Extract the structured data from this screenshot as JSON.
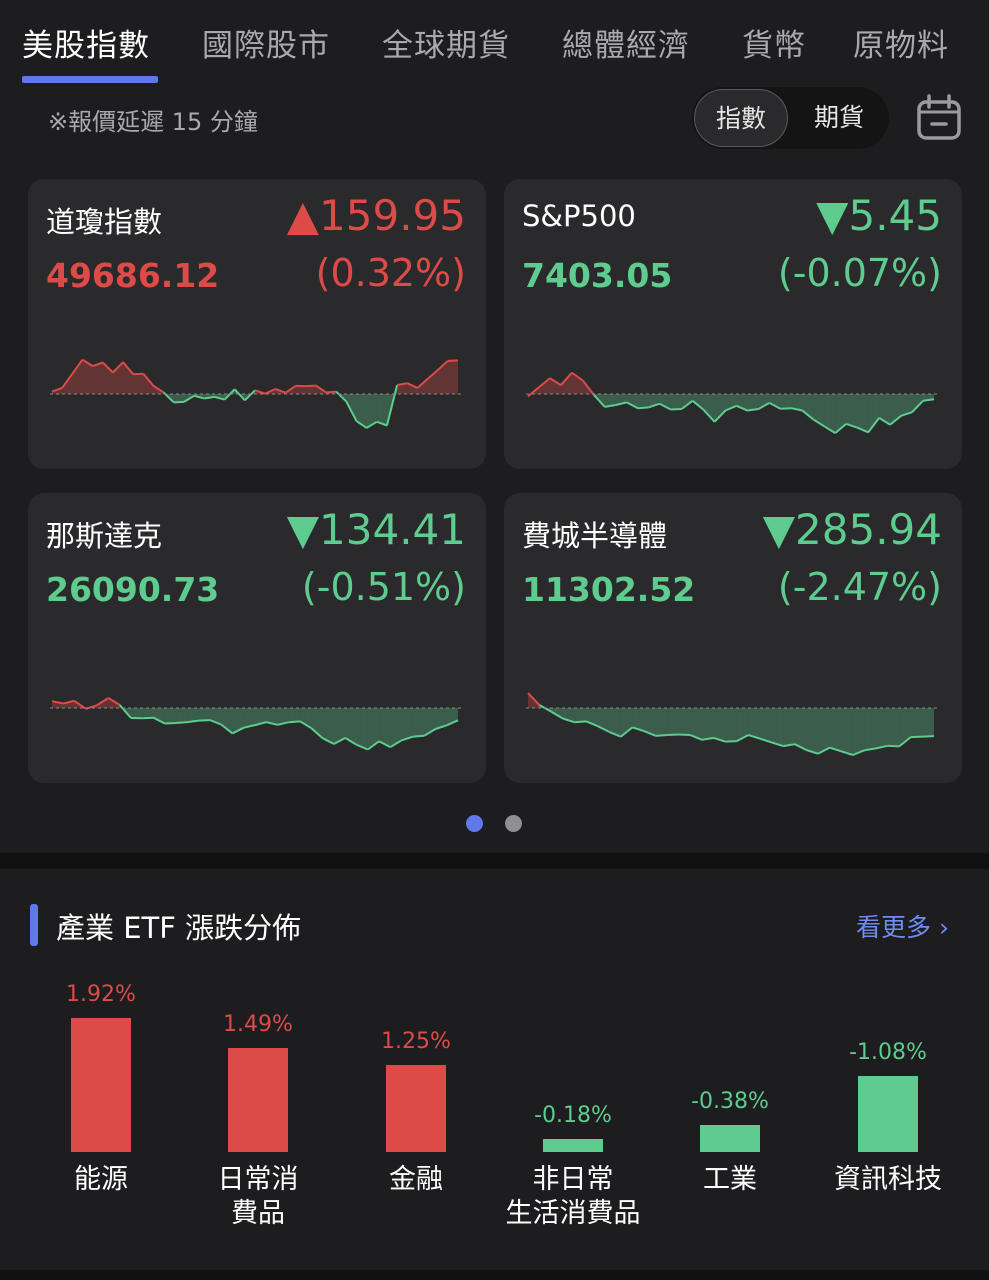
{
  "tabs": [
    "美股指數",
    "國際股市",
    "全球期貨",
    "總體經濟",
    "貨幣",
    "原物料"
  ],
  "delay_note": "※報價延遲 15 分鐘",
  "segment": {
    "active": "指數",
    "inactive": "期貨"
  },
  "cards": [
    {
      "name": "道瓊指數",
      "change": "▲159.95",
      "price": "49686.12",
      "pct": "(0.32%)",
      "direction": "up"
    },
    {
      "name": "S&P500",
      "change": "▼5.45",
      "price": "7403.05",
      "pct": "(-0.07%)",
      "direction": "down"
    },
    {
      "name": "那斯達克",
      "change": "▼134.41",
      "price": "26090.73",
      "pct": "(-0.51%)",
      "direction": "down"
    },
    {
      "name": "費城半導體",
      "change": "▼285.94",
      "price": "11302.52",
      "pct": "(-2.47%)",
      "direction": "down"
    }
  ],
  "etf_section": {
    "title": "產業 ETF 漲跌分佈",
    "see_more": "看更多 ›",
    "items": [
      {
        "label_line1": "能源",
        "label_line2": "",
        "value": "1.92%",
        "pct": 1.92
      },
      {
        "label_line1": "日常消",
        "label_line2": "費品",
        "value": "1.49%",
        "pct": 1.49
      },
      {
        "label_line1": "金融",
        "label_line2": "",
        "value": "1.25%",
        "pct": 1.25
      },
      {
        "label_line1": "非日常",
        "label_line2": "生活消費品",
        "value": "-0.18%",
        "pct": -0.18
      },
      {
        "label_line1": "工業",
        "label_line2": "",
        "value": "-0.38%",
        "pct": -0.38
      },
      {
        "label_line1": "資訊科技",
        "label_line2": "",
        "value": "-1.08%",
        "pct": -1.08
      }
    ]
  },
  "colors": {
    "up": "#dc4b47",
    "down": "#5ecc8e",
    "accent": "#5f78ea",
    "link": "#6f8cf2"
  },
  "icons": {
    "calendar": "calendar-icon"
  }
}
